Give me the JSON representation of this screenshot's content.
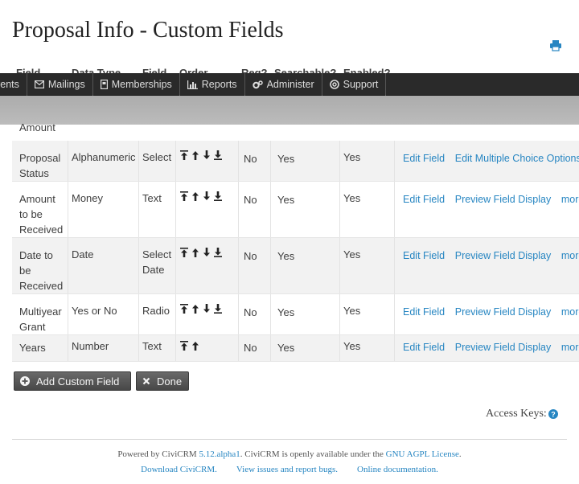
{
  "page": {
    "title": "Proposal Info - Custom Fields"
  },
  "header": {
    "print_icon": "print-icon"
  },
  "table": {
    "columns": [
      "Field",
      "Data Type",
      "Field",
      "Order",
      "Req?",
      "Searchable?",
      "Enabled?"
    ],
    "partial_first_row_label": "Amount",
    "rows": [
      {
        "label": "Proposal Status",
        "label_lines": [
          "Proposal",
          "Status"
        ],
        "data_type": "Alphanumeric",
        "field_type": [
          "Select"
        ],
        "order_icons": [
          "move-top-icon",
          "move-up-icon",
          "move-down-icon",
          "move-bottom-icon"
        ],
        "req": "No",
        "searchable": "Yes",
        "enabled": "Yes",
        "links": [
          "Edit Field",
          "Edit Multiple Choice Options"
        ]
      },
      {
        "label": "Amount to be Received",
        "label_lines": [
          "Amount",
          "to be",
          "Received"
        ],
        "data_type": "Money",
        "field_type": [
          "Text"
        ],
        "order_icons": [
          "move-top-icon",
          "move-up-icon",
          "move-down-icon",
          "move-bottom-icon"
        ],
        "req": "No",
        "searchable": "Yes",
        "enabled": "Yes",
        "links": [
          "Edit Field",
          "Preview Field Display",
          "more"
        ]
      },
      {
        "label": "Date to be Received",
        "label_lines": [
          "Date to",
          "be",
          "Received"
        ],
        "data_type": "Date",
        "field_type": [
          "Select",
          "Date"
        ],
        "order_icons": [
          "move-top-icon",
          "move-up-icon",
          "move-down-icon",
          "move-bottom-icon"
        ],
        "req": "No",
        "searchable": "Yes",
        "enabled": "Yes",
        "links": [
          "Edit Field",
          "Preview Field Display",
          "more"
        ]
      },
      {
        "label": "Multiyear Grant",
        "label_lines": [
          "Multiyear",
          "Grant"
        ],
        "data_type": "Yes or No",
        "field_type": [
          "Radio"
        ],
        "order_icons": [
          "move-top-icon",
          "move-up-icon",
          "move-down-icon",
          "move-bottom-icon"
        ],
        "req": "No",
        "searchable": "Yes",
        "enabled": "Yes",
        "links": [
          "Edit Field",
          "Preview Field Display",
          "more"
        ]
      },
      {
        "label": "Years",
        "label_lines": [
          "Years"
        ],
        "data_type": "Number",
        "field_type": [
          "Text"
        ],
        "order_icons": [
          "move-top-icon",
          "move-up-icon"
        ],
        "req": "No",
        "searchable": "Yes",
        "enabled": "Yes",
        "links": [
          "Edit Field",
          "Preview Field Display",
          "more"
        ]
      }
    ]
  },
  "menubar": {
    "items": [
      {
        "label": "vents",
        "icon": ""
      },
      {
        "label": "Mailings",
        "icon": "envelope-icon"
      },
      {
        "label": "Memberships",
        "icon": "id-card-icon"
      },
      {
        "label": "Reports",
        "icon": "bar-chart-icon"
      },
      {
        "label": "Administer",
        "icon": "gears-icon"
      },
      {
        "label": "Support",
        "icon": "life-ring-icon"
      }
    ]
  },
  "buttons": {
    "add_custom_field": "Add Custom Field",
    "done": "Done"
  },
  "access_keys": {
    "label": "Access Keys:"
  },
  "footer": {
    "powered_by_prefix": "Powered by CiviCRM ",
    "version": "5.12.alpha1",
    "available_text": ". CiviCRM is openly available under the ",
    "license": "GNU AGPL License",
    "license_suffix": ".",
    "download": "Download CiviCRM.",
    "issues": "View issues and report bugs.",
    "docs": "Online documentation."
  },
  "colors": {
    "link": "#2786c2",
    "menubar_bg": "#2a2a2a",
    "row_alt": "#f2f2f2"
  }
}
